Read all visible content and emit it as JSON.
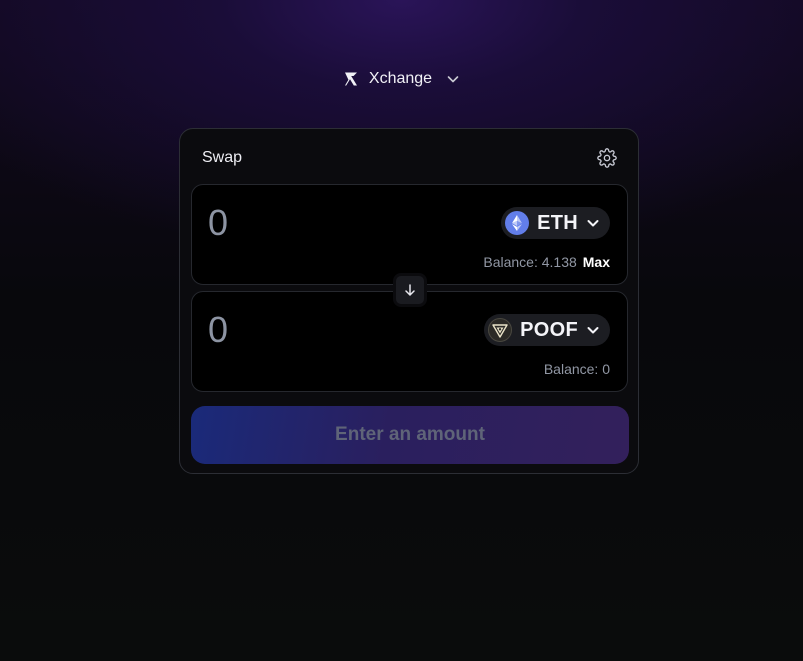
{
  "brand": {
    "name": "Xchange",
    "logo_icon": "xchange-logo-icon",
    "dropdown_icon": "chevron-down-icon"
  },
  "swap": {
    "title": "Swap",
    "settings_icon": "gear-icon",
    "from": {
      "amount_placeholder": "0",
      "token": "ETH",
      "token_icon": "ethereum-icon",
      "balance_label": "Balance: 4.138",
      "max_label": "Max"
    },
    "switch_icon": "arrow-down-icon",
    "to": {
      "amount_placeholder": "0",
      "token": "POOF",
      "token_icon": "poof-token-icon",
      "balance_label": "Balance: 0"
    },
    "submit_label": "Enter an amount"
  },
  "colors": {
    "accent_purple": "#2a1458",
    "eth_blue": "#627eea",
    "panel_bg": "#000000",
    "muted_text": "#9197a4"
  }
}
